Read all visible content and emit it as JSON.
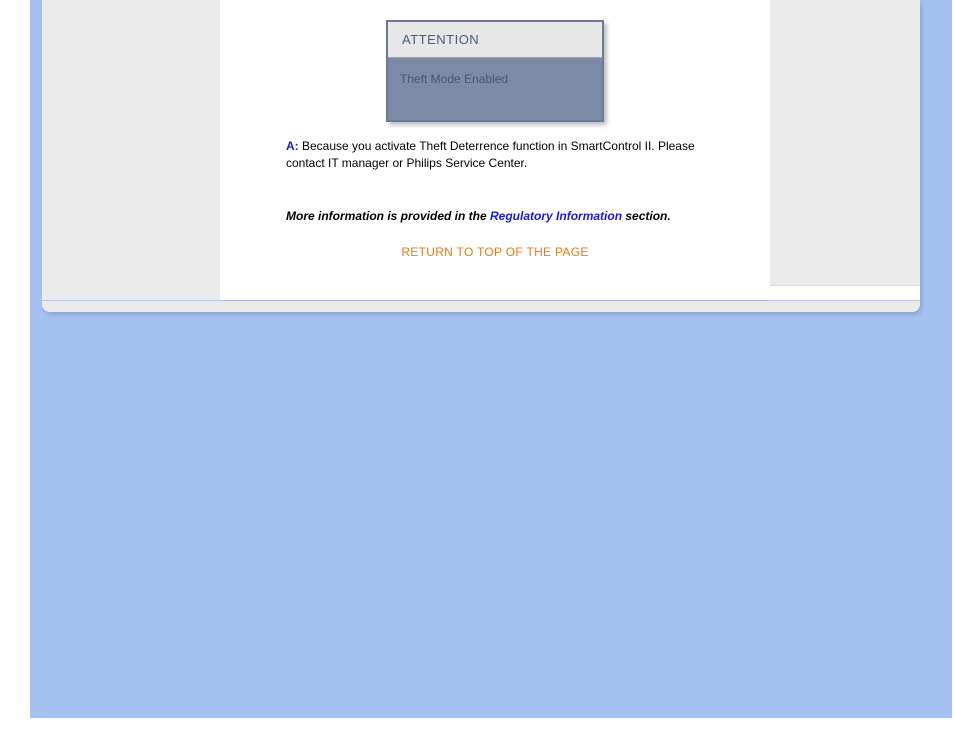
{
  "attention": {
    "title": "ATTENTION",
    "message": "Theft Mode Enabled"
  },
  "answer": {
    "label": "A:",
    "text": " Because you activate Theft Deterrence function in SmartControl II. Please contact IT manager or Philips Service Center."
  },
  "more_info": {
    "before": "More information is provided in the ",
    "link": "Regulatory Information",
    "after": " section."
  },
  "return_link": "RETURN TO TOP OF THE PAGE"
}
